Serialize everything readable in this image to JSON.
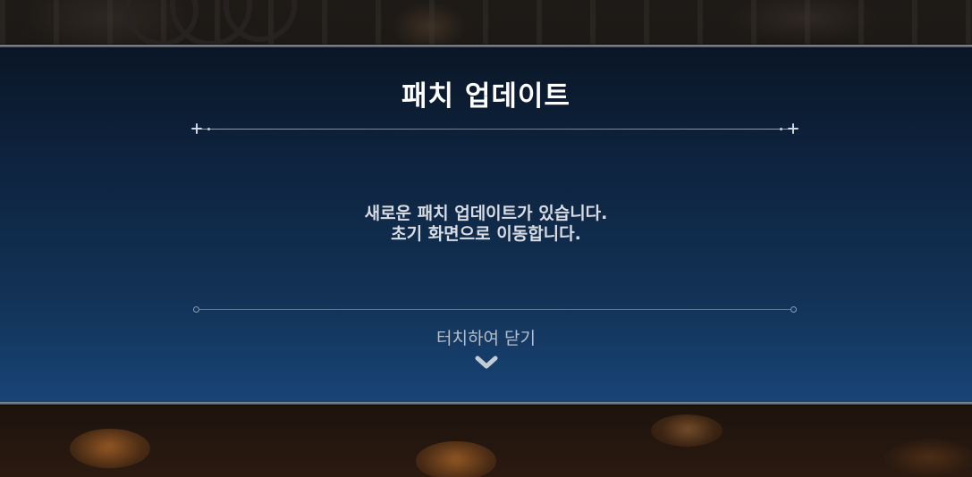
{
  "popup": {
    "title": "패치 업데이트",
    "message_line1": "새로운 패치 업데이트가 있습니다.",
    "message_line2": "초기 화면으로 이동합니다.",
    "close_hint": "터치하여 닫기",
    "chevron_icon": "chevron-down-icon"
  },
  "colors": {
    "popup_top": "#0a1626",
    "popup_bottom": "#184577",
    "title": "#ffffff",
    "message": "#d9dde3",
    "close_hint": "#b7bfca"
  }
}
